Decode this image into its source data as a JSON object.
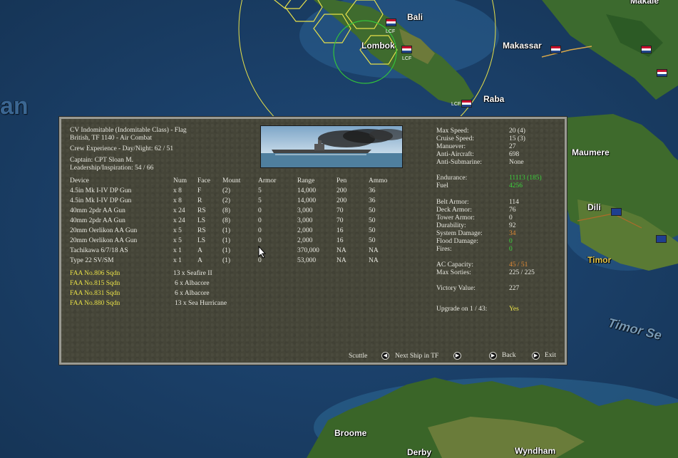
{
  "map": {
    "places": {
      "bali": "Bali",
      "lombok": "Lombok",
      "makassar": "Makassar",
      "raba": "Raba",
      "maumere": "Maumere",
      "dili": "Dili",
      "timor": "Timor",
      "timor_sea": "Timor Se",
      "broome": "Broome",
      "derby": "Derby",
      "wyndham": "Wyndham",
      "makale": "Makale",
      "ocean_fragment": "an"
    },
    "base_tag": "LCF"
  },
  "ship": {
    "title": "CV Indomitable (Indomitable Class) - Flag",
    "task_force": "British, TF 1140 - Air Combat",
    "crew_experience": "Crew Experience - Day/Night: 62 / 51",
    "captain": "Captain: CPT Sloan M.",
    "leadership": "Leadership/Inspiration: 54 / 66"
  },
  "devices": {
    "headers": [
      "Device",
      "Num",
      "Face",
      "Mount",
      "Armor",
      "Range",
      "Pen",
      "Ammo"
    ],
    "rows": [
      [
        "4.5in Mk I-IV DP Gun",
        "x 8",
        "F",
        "(2)",
        "5",
        "14,000",
        "200",
        "36"
      ],
      [
        "4.5in Mk I-IV DP Gun",
        "x 8",
        "R",
        "(2)",
        "5",
        "14,000",
        "200",
        "36"
      ],
      [
        "40mm 2pdr AA Gun",
        "x 24",
        "RS",
        "(8)",
        "0",
        "3,000",
        "70",
        "50"
      ],
      [
        "40mm 2pdr AA Gun",
        "x 24",
        "LS",
        "(8)",
        "0",
        "3,000",
        "70",
        "50"
      ],
      [
        "20mm Oerlikon AA Gun",
        "x 5",
        "RS",
        "(1)",
        "0",
        "2,000",
        "16",
        "50"
      ],
      [
        "20mm Oerlikon AA Gun",
        "x 5",
        "LS",
        "(1)",
        "0",
        "2,000",
        "16",
        "50"
      ],
      [
        "Tachikawa 6/7/18 AS",
        "x 1",
        "A",
        "(1)",
        "0",
        "370,000",
        "NA",
        "NA"
      ],
      [
        "Type 22 SV/SM",
        "x 1",
        "A",
        "(1)",
        "0",
        "53,000",
        "NA",
        "NA"
      ]
    ]
  },
  "air_groups": [
    {
      "name": "FAA No.806 Sqdn",
      "aircraft": "13 x Seafire II"
    },
    {
      "name": "FAA No.815 Sqdn",
      "aircraft": "6 x Albacore"
    },
    {
      "name": "FAA No.831 Sqdn",
      "aircraft": "6 x Albacore"
    },
    {
      "name": "FAA No.880 Sqdn",
      "aircraft": "13 x Sea Hurricane"
    }
  ],
  "stats": {
    "max_speed_label": "Max Speed:",
    "max_speed": "20 (4)",
    "cruise_speed_label": "Cruise Speed:",
    "cruise_speed": "15 (3)",
    "manuever_label": "Manuever:",
    "manuever": "27",
    "anti_aircraft_label": "Anti-Aircraft:",
    "anti_aircraft": "698",
    "anti_submarine_label": "Anti-Submarine:",
    "anti_submarine": "None",
    "endurance_label": "Endurance:",
    "endurance": "11113 (185)",
    "fuel_label": "Fuel",
    "fuel": "4256",
    "belt_armor_label": "Belt Armor:",
    "belt_armor": "114",
    "deck_armor_label": "Deck Armor:",
    "deck_armor": "76",
    "tower_armor_label": "Tower Armor:",
    "tower_armor": "0",
    "durability_label": "Durability:",
    "durability": "92",
    "system_damage_label": "System Damage:",
    "system_damage": "34",
    "flood_damage_label": "Flood Damage:",
    "flood_damage": "0",
    "fires_label": "Fires:",
    "fires": "0",
    "ac_capacity_label": "AC Capacity:",
    "ac_capacity": "45 / 51",
    "max_sorties_label": "Max Sorties:",
    "max_sorties": "225 / 225",
    "victory_value_label": "Victory Value:",
    "victory_value": "227",
    "upgrade_label": "Upgrade on 1 / 43:",
    "upgrade": "Yes"
  },
  "buttons": {
    "scuttle": "Scuttle",
    "next_ship": "Next Ship in TF",
    "back": "Back",
    "exit": "Exit"
  },
  "colors": {
    "panel_bg": "#454538",
    "highlight_yellow": "#e8e048",
    "highlight_green": "#3cd23c",
    "highlight_orange": "#e08a36"
  }
}
